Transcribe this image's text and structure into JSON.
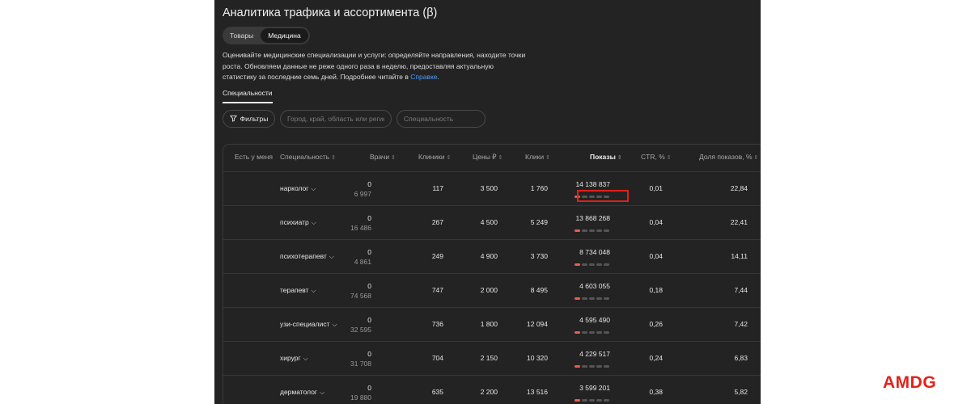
{
  "page": {
    "title": "Аналитика трафика и ассортимента (β)",
    "segments": [
      {
        "label": "Товары",
        "active": false
      },
      {
        "label": "Медицина",
        "active": true
      }
    ],
    "description": "Оценивайте медицинские специализации и услуги: определяйте направления, находите точки роста. Обновляем данные не реже одного раза в неделю, предоставляя актуальную статистику за последние семь дней. Подробнее читайте в ",
    "description_link": "Справке",
    "description_end": ".",
    "subtab": "Специальности"
  },
  "filters": {
    "button_label": "Фильтры",
    "region_placeholder": "Город, край, область или регион",
    "specialty_placeholder": "Специальность"
  },
  "table": {
    "headers": {
      "have": "Есть у меня",
      "specialty": "Специальность",
      "doctors": "Врачи",
      "clinics": "Клиники",
      "prices": "Цены ₽",
      "clicks": "Клики",
      "shows": "Показы",
      "ctr": "CTR, %",
      "share": "Доля показов, %"
    },
    "rows": [
      {
        "specialty": "нарколог",
        "doctors_top": "0",
        "doctors_bottom": "6 997",
        "clinics": "117",
        "prices": "3 500",
        "clicks": "1 760",
        "shows": "14 138 837",
        "ctr": "0,01",
        "share": "22,84",
        "level": 1
      },
      {
        "specialty": "психиатр",
        "doctors_top": "0",
        "doctors_bottom": "16 486",
        "clinics": "267",
        "prices": "4 500",
        "clicks": "5 249",
        "shows": "13 868 268",
        "ctr": "0,04",
        "share": "22,41",
        "level": 1
      },
      {
        "specialty": "психотерапевт",
        "doctors_top": "0",
        "doctors_bottom": "4 861",
        "clinics": "249",
        "prices": "4 900",
        "clicks": "3 730",
        "shows": "8 734 048",
        "ctr": "0,04",
        "share": "14,11",
        "level": 1
      },
      {
        "specialty": "терапевт",
        "doctors_top": "0",
        "doctors_bottom": "74 568",
        "clinics": "747",
        "prices": "2 000",
        "clicks": "8 495",
        "shows": "4 603 055",
        "ctr": "0,18",
        "share": "7,44",
        "level": 1
      },
      {
        "specialty": "узи-специалист",
        "doctors_top": "0",
        "doctors_bottom": "32 595",
        "clinics": "736",
        "prices": "1 800",
        "clicks": "12 094",
        "shows": "4 595 490",
        "ctr": "0,26",
        "share": "7,42",
        "level": 1
      },
      {
        "specialty": "хирург",
        "doctors_top": "0",
        "doctors_bottom": "31 708",
        "clinics": "704",
        "prices": "2 150",
        "clicks": "10 320",
        "shows": "4 229 517",
        "ctr": "0,24",
        "share": "6,83",
        "level": 1
      },
      {
        "specialty": "дерматолог",
        "doctors_top": "0",
        "doctors_bottom": "19 880",
        "clinics": "635",
        "prices": "2 200",
        "clicks": "13 516",
        "shows": "3 599 201",
        "ctr": "0,38",
        "share": "5,82",
        "level": 1
      }
    ]
  },
  "brand": "AMDG",
  "colors": {
    "app_bg": "#232323",
    "accent_bar": "#ef5b4b",
    "highlight": "#e0201a",
    "link": "#4a9bff",
    "brand": "#e2231a"
  }
}
